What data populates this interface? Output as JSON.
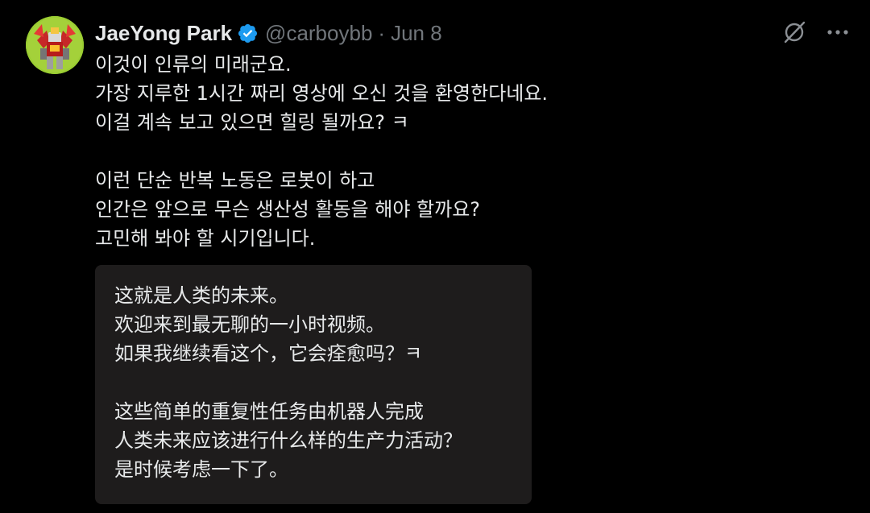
{
  "author": {
    "display_name": "JaeYong Park",
    "handle": "@carboybb",
    "separator": "·",
    "date": "Jun 8",
    "verified": true,
    "verified_color": "#1d9bf0"
  },
  "actions": {
    "grok_icon": "grok-icon",
    "more_icon": "more-icon"
  },
  "tweet": {
    "lines": [
      "이것이 인류의 미래군요.",
      "가장 지루한 1시간 짜리 영상에 오신 것을 환영한다네요.",
      "이걸 계속 보고 있으면 힐링 될까요? ㅋ",
      "",
      "이런 단순 반복 노동은 로봇이 하고",
      "인간은 앞으로 무슨 생산성 활동을 해야 할까요?",
      "고민해 봐야 할 시기입니다."
    ]
  },
  "translation": {
    "lines": [
      "这就是人类的未来。",
      "欢迎来到最无聊的一小时视频。",
      "如果我继续看这个，它会痊愈吗？ㅋ",
      "",
      "这些简单的重复性任务由机器人完成",
      "人类未来应该进行什么样的生产力活动？",
      "是时候考虑一下了。"
    ]
  },
  "colors": {
    "background": "#000000",
    "text": "#e7e9ea",
    "secondary_text": "#71767b",
    "translation_bg": "#1e1c1c",
    "brand_blue": "#1d9bf0"
  }
}
